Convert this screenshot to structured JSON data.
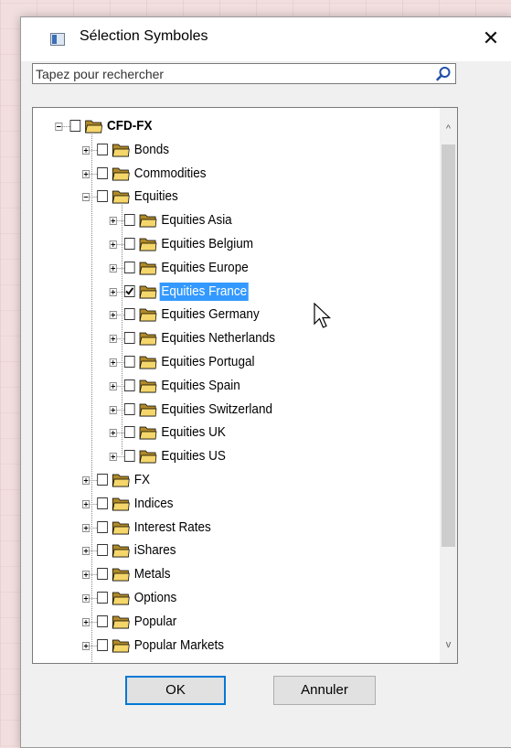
{
  "dialog": {
    "title": "Sélection Symboles",
    "close_glyph": "✕"
  },
  "search": {
    "placeholder": "Tapez pour rechercher",
    "value": "",
    "icon": "search-icon"
  },
  "tree": {
    "nodes": [
      {
        "label": "CFD-FX",
        "level": 0,
        "expanded": true,
        "checked": false,
        "bold": true,
        "selected": false
      },
      {
        "label": "Bonds",
        "level": 1,
        "expanded": false,
        "checked": false,
        "bold": false,
        "selected": false
      },
      {
        "label": "Commodities",
        "level": 1,
        "expanded": false,
        "checked": false,
        "bold": false,
        "selected": false
      },
      {
        "label": "Equities",
        "level": 1,
        "expanded": true,
        "checked": false,
        "bold": false,
        "selected": false
      },
      {
        "label": "Equities Asia",
        "level": 2,
        "expanded": false,
        "checked": false,
        "bold": false,
        "selected": false
      },
      {
        "label": "Equities Belgium",
        "level": 2,
        "expanded": false,
        "checked": false,
        "bold": false,
        "selected": false
      },
      {
        "label": "Equities Europe",
        "level": 2,
        "expanded": false,
        "checked": false,
        "bold": false,
        "selected": false
      },
      {
        "label": "Equities France",
        "level": 2,
        "expanded": false,
        "checked": true,
        "bold": false,
        "selected": true
      },
      {
        "label": "Equities Germany",
        "level": 2,
        "expanded": false,
        "checked": false,
        "bold": false,
        "selected": false
      },
      {
        "label": "Equities Netherlands",
        "level": 2,
        "expanded": false,
        "checked": false,
        "bold": false,
        "selected": false
      },
      {
        "label": "Equities Portugal",
        "level": 2,
        "expanded": false,
        "checked": false,
        "bold": false,
        "selected": false
      },
      {
        "label": "Equities Spain",
        "level": 2,
        "expanded": false,
        "checked": false,
        "bold": false,
        "selected": false
      },
      {
        "label": "Equities Switzerland",
        "level": 2,
        "expanded": false,
        "checked": false,
        "bold": false,
        "selected": false
      },
      {
        "label": "Equities UK",
        "level": 2,
        "expanded": false,
        "checked": false,
        "bold": false,
        "selected": false
      },
      {
        "label": "Equities US",
        "level": 2,
        "expanded": false,
        "checked": false,
        "bold": false,
        "selected": false
      },
      {
        "label": "FX",
        "level": 1,
        "expanded": false,
        "checked": false,
        "bold": false,
        "selected": false
      },
      {
        "label": "Indices",
        "level": 1,
        "expanded": false,
        "checked": false,
        "bold": false,
        "selected": false
      },
      {
        "label": "Interest Rates",
        "level": 1,
        "expanded": false,
        "checked": false,
        "bold": false,
        "selected": false
      },
      {
        "label": "iShares",
        "level": 1,
        "expanded": false,
        "checked": false,
        "bold": false,
        "selected": false
      },
      {
        "label": "Metals",
        "level": 1,
        "expanded": false,
        "checked": false,
        "bold": false,
        "selected": false
      },
      {
        "label": "Options",
        "level": 1,
        "expanded": false,
        "checked": false,
        "bold": false,
        "selected": false
      },
      {
        "label": "Popular",
        "level": 1,
        "expanded": false,
        "checked": false,
        "bold": false,
        "selected": false
      },
      {
        "label": "Popular Markets",
        "level": 1,
        "expanded": false,
        "checked": false,
        "bold": false,
        "selected": false
      }
    ]
  },
  "scrollbar": {
    "up_glyph": "^",
    "down_glyph": "v"
  },
  "buttons": {
    "ok": "OK",
    "cancel": "Annuler"
  },
  "colors": {
    "selection": "#3399ff",
    "folder": "#f5d66b",
    "accent": "#0078d7"
  }
}
